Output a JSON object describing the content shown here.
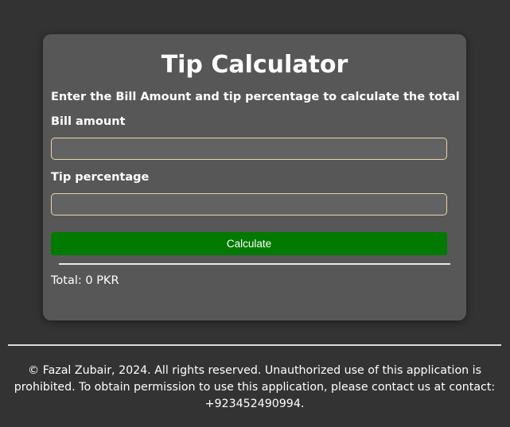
{
  "app": {
    "title": "Tip Calculator",
    "subtitle": "Enter the Bill Amount and tip percentage to calculate the total"
  },
  "form": {
    "bill_label": "Bill amount",
    "bill_value": "",
    "tip_label": "Tip percentage",
    "tip_value": "",
    "calculate_label": "Calculate"
  },
  "result": {
    "total_text": "Total: 0 PKR"
  },
  "footer": {
    "text": "© Fazal Zubair, 2024. All rights reserved. Unauthorized use of this application is prohibited. To obtain permission to use this application, please contact us at contact: +923452490994."
  },
  "colors": {
    "page_background": "#333333",
    "card_background": "#575757",
    "button_background": "#007a00",
    "input_border": "#e6d7a8"
  }
}
